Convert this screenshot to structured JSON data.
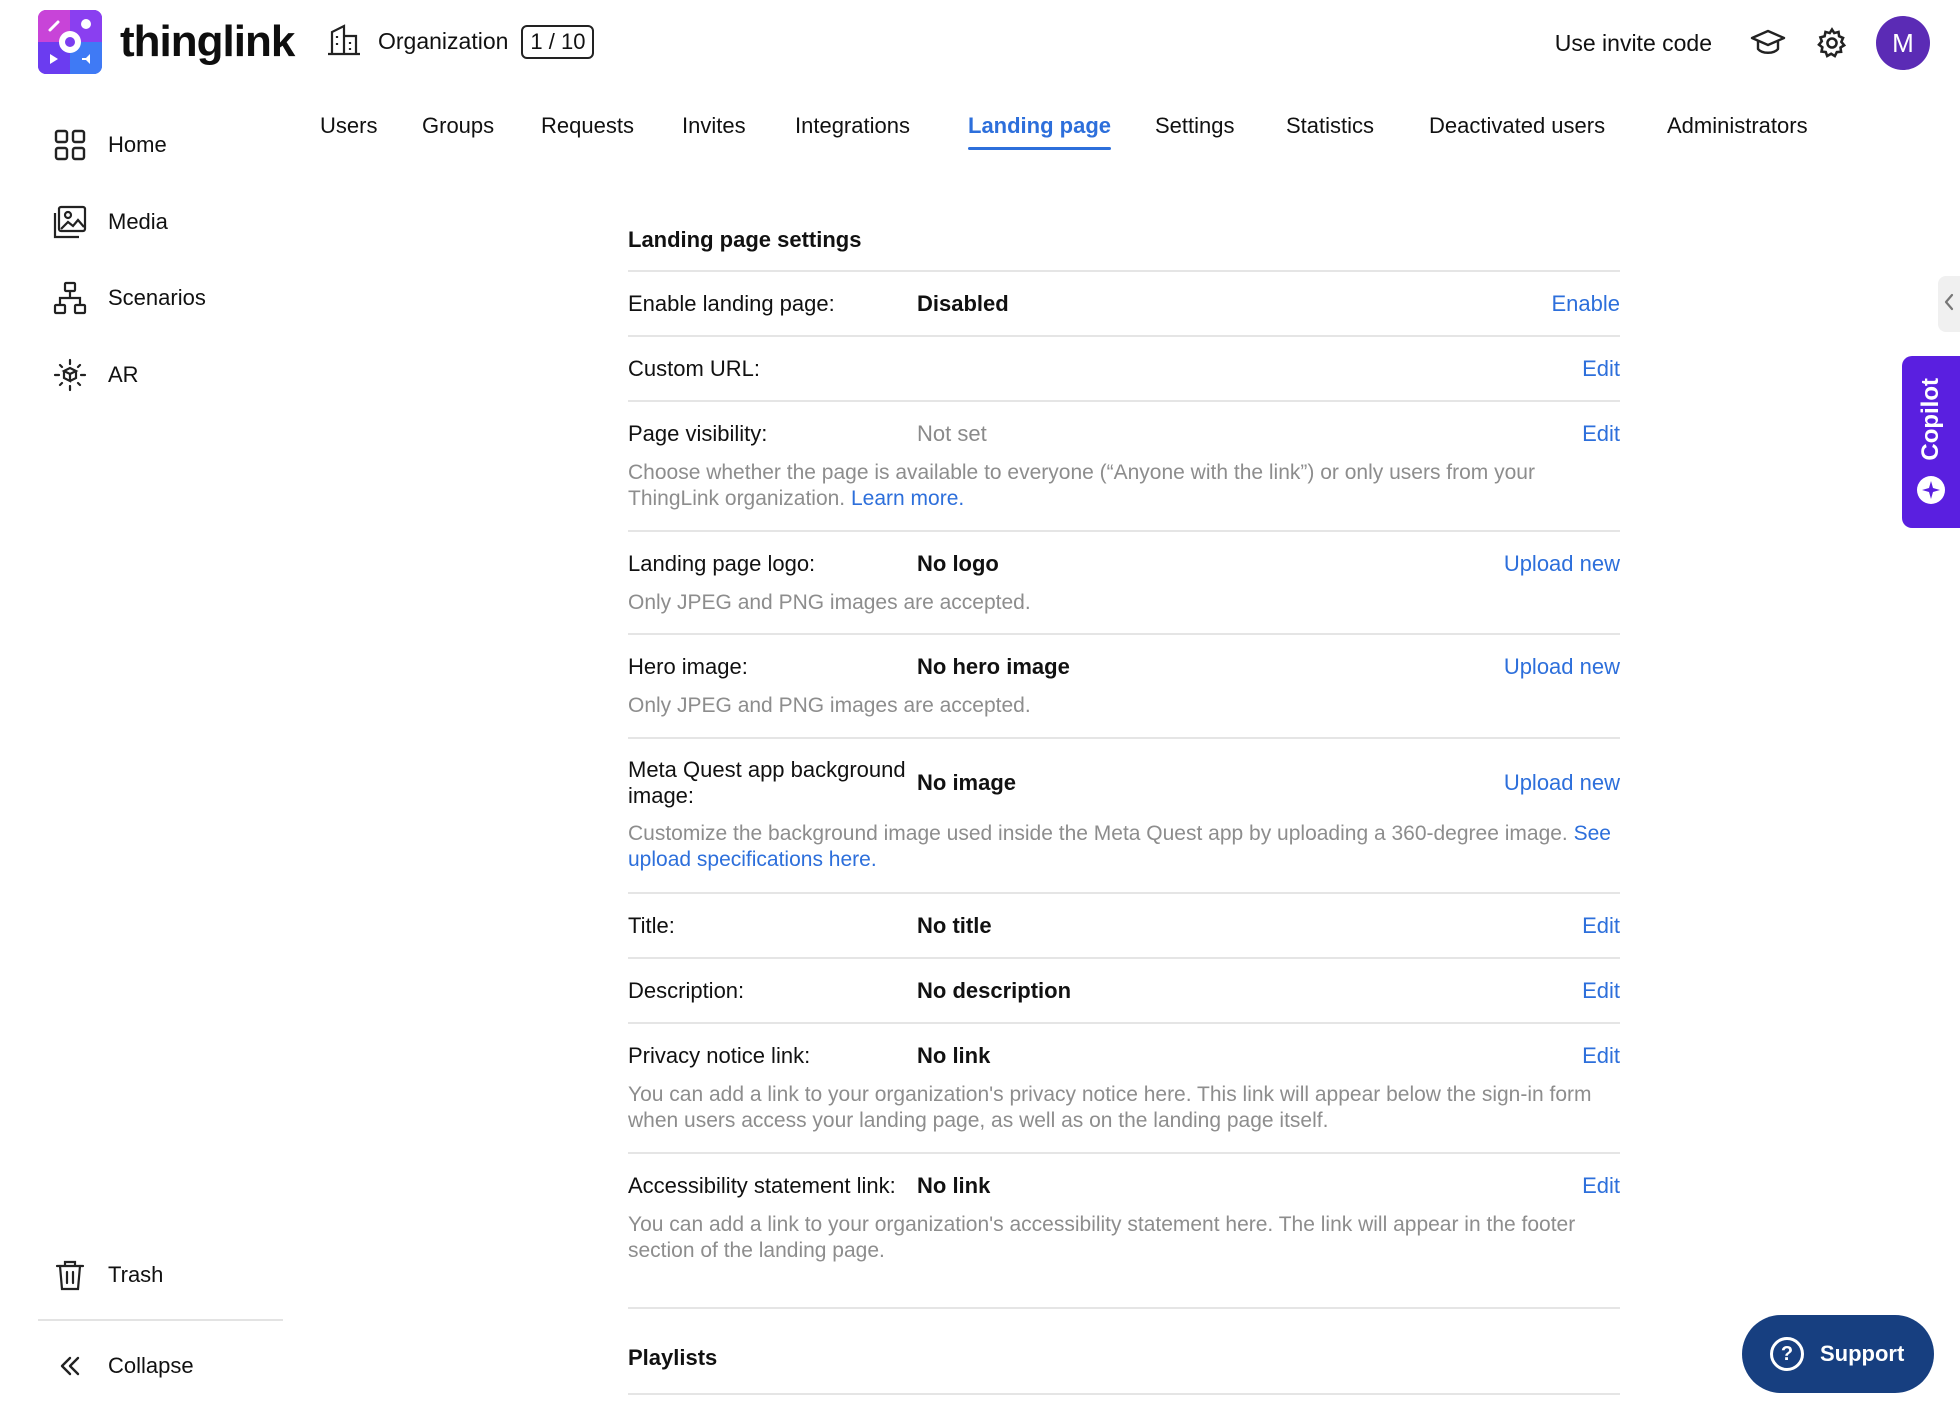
{
  "brand": {
    "name": "thinglink"
  },
  "org": {
    "label": "Organization",
    "badge": "1 / 10"
  },
  "header": {
    "invite_label": "Use invite code",
    "avatar_initial": "M"
  },
  "sidebar": {
    "items": [
      {
        "label": "Home"
      },
      {
        "label": "Media"
      },
      {
        "label": "Scenarios"
      },
      {
        "label": "AR"
      }
    ],
    "trash_label": "Trash",
    "collapse_label": "Collapse"
  },
  "tabs": [
    {
      "label": "Users"
    },
    {
      "label": "Groups"
    },
    {
      "label": "Requests"
    },
    {
      "label": "Invites"
    },
    {
      "label": "Integrations"
    },
    {
      "label": "Landing page",
      "active": true
    },
    {
      "label": "Settings"
    },
    {
      "label": "Statistics"
    },
    {
      "label": "Deactivated users"
    },
    {
      "label": "Administrators"
    }
  ],
  "settings": {
    "section_title": "Landing page settings",
    "rows": [
      {
        "label": "Enable landing page:",
        "value": "Disabled",
        "action": "Enable"
      },
      {
        "label": "Custom URL:",
        "value": "",
        "action": "Edit"
      },
      {
        "label": "Page visibility:",
        "value": "Not set",
        "action": "Edit",
        "desc": "Choose whether the page is available to everyone (“Anyone with the link”) or only users from your ThingLink organization.",
        "desc_link": "Learn more."
      },
      {
        "label": "Landing page logo:",
        "value": "No logo",
        "action": "Upload new",
        "desc": "Only JPEG and PNG images are accepted."
      },
      {
        "label": "Hero image:",
        "value": "No hero image",
        "action": "Upload new",
        "desc": "Only JPEG and PNG images are accepted."
      },
      {
        "label": "Meta Quest app background image:",
        "value": "No image",
        "action": "Upload new",
        "desc": "Customize the background image used inside the Meta Quest app by uploading a 360-degree image.",
        "desc_link": "See upload specifications here."
      },
      {
        "label": "Title:",
        "value": "No title",
        "action": "Edit"
      },
      {
        "label": "Description:",
        "value": "No description",
        "action": "Edit"
      },
      {
        "label": "Privacy notice link:",
        "value": "No link",
        "action": "Edit",
        "desc": "You can add a link to your organization's privacy notice here. This link will appear below the sign-in form when users access your landing page, as well as on the landing page itself."
      },
      {
        "label": "Accessibility statement link:",
        "value": "No link",
        "action": "Edit",
        "desc": "You can add a link to your organization's accessibility statement here. The link will appear in the footer section of the landing page."
      }
    ],
    "playlists_title": "Playlists"
  },
  "copilot": {
    "label": "Copilot"
  },
  "support": {
    "label": "Support"
  },
  "colors": {
    "accent": "#2d6fdb",
    "copilot": "#5a1fe0",
    "support": "#173f80",
    "avatar": "#5b2bb5"
  },
  "icons": [
    "building-icon",
    "graduation-cap-icon",
    "gear-icon",
    "home-grid-icon",
    "media-icon",
    "scenarios-icon",
    "ar-icon",
    "trash-icon",
    "collapse-icon",
    "chevron-left-icon",
    "sparkle-icon",
    "help-circle-icon"
  ]
}
